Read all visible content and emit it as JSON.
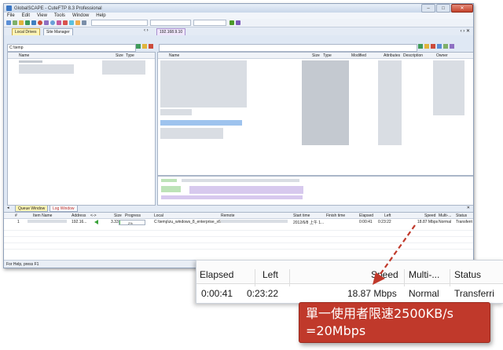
{
  "window": {
    "title": "GlobalSCAPE - CuteFTP 8.3 Professional",
    "controls": [
      "–",
      "□",
      "✕"
    ]
  },
  "menu": [
    "File",
    "Edit",
    "View",
    "Tools",
    "Window",
    "Help"
  ],
  "left_tabs": [
    {
      "label": "Local Drives",
      "active": true
    },
    {
      "label": "Site Manager",
      "active": false
    }
  ],
  "right_tab": {
    "label": "192.168.9.10"
  },
  "local_path": "C:\\temp",
  "local_columns": [
    "Name",
    "Size",
    "Type"
  ],
  "remote_columns": [
    "Name",
    "Size",
    "Type",
    "Modified",
    "Attributes",
    "Description",
    "Owner"
  ],
  "queue_tabs": [
    {
      "label": "Queue Window",
      "active": true
    },
    {
      "label": "Log Window",
      "active": false
    }
  ],
  "queue_columns": [
    "#",
    "Item Name",
    "Address",
    "<->",
    "Size",
    "Progress",
    "Local",
    "Remote",
    "Start time",
    "Finish time",
    "Elapsed",
    "Left",
    "Speed",
    "Multi-...",
    "Status"
  ],
  "queue_row": {
    "index": "1",
    "address": "192.16...",
    "size": "3.33 GB",
    "progress_pct": 2,
    "progress_text": "2%",
    "local": "C:\\temp\\zu_windows_8_enterprise_x6...",
    "start_time": "2012/6/8 上午 1...",
    "elapsed": "0:00:41",
    "left": "0:23:22",
    "speed": "18.87 Mbps",
    "multi": "Normal",
    "status": "Transferri"
  },
  "statusbar": "For Help, press F1",
  "zoom": {
    "headers": [
      "Elapsed",
      "Left",
      "Speed",
      "Multi-...",
      "Status"
    ],
    "elapsed": "0:00:41",
    "left": "0:23:22",
    "speed": "18.87 Mbps",
    "multi": "Normal",
    "status": "Transferri"
  },
  "callout": {
    "line1": "單一使用者限速2500KB/s",
    "line2": "=20Mbps"
  },
  "colors": {
    "callout_bg": "#c0392b",
    "arrow": "#c0392b",
    "progress": "#5fbf5f"
  }
}
